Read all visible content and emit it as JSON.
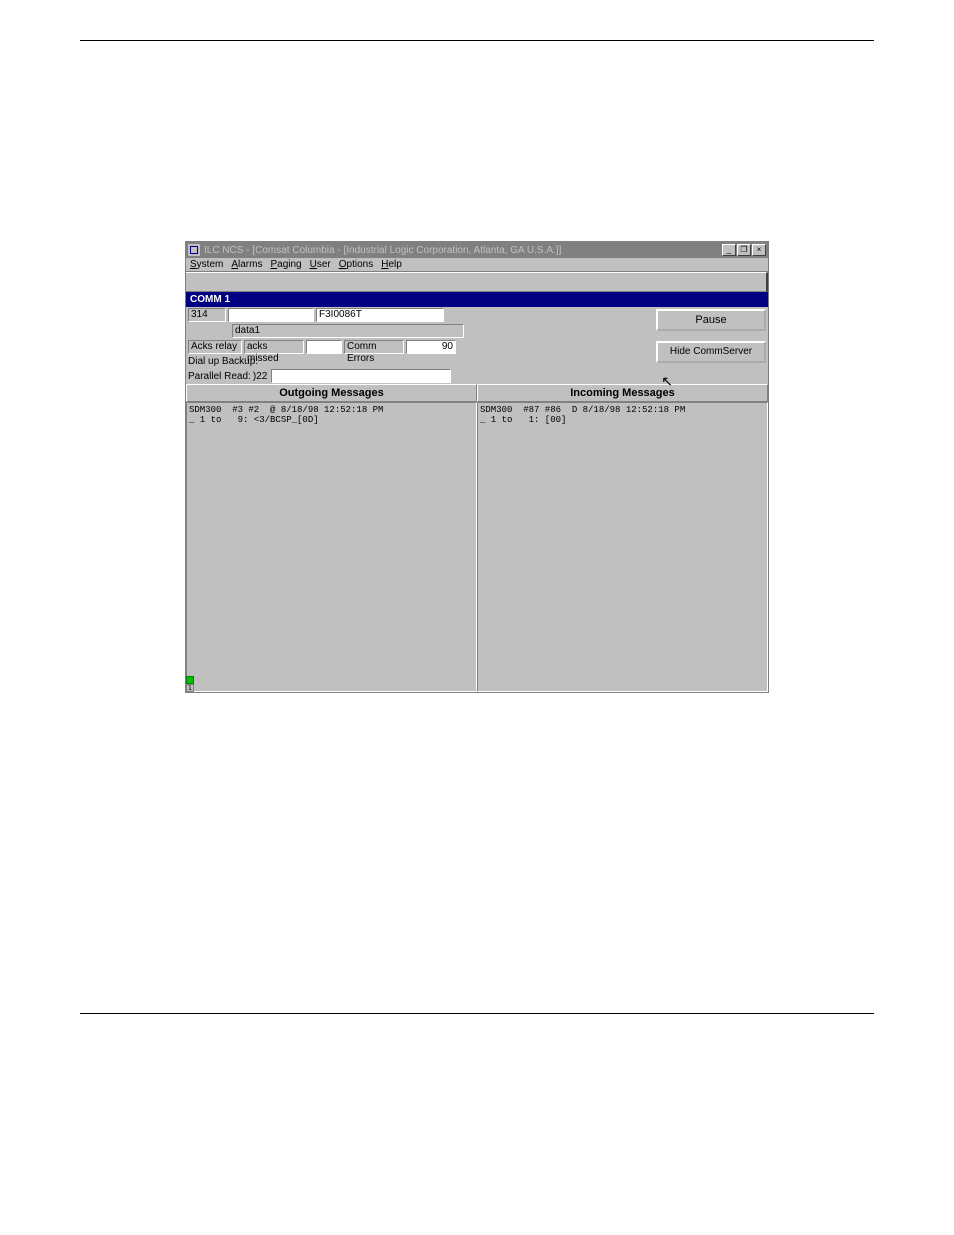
{
  "window": {
    "title": "ILC NCS - [Comsat Columbia - [Industrial Logic Corporation, Atlanta, GA U.S.A.]]"
  },
  "menu": {
    "items": [
      {
        "label": "System",
        "ul": "S"
      },
      {
        "label": "Alarms",
        "ul": "A"
      },
      {
        "label": "Paging",
        "ul": "P"
      },
      {
        "label": "User",
        "ul": "U"
      },
      {
        "label": "Options",
        "ul": "O"
      },
      {
        "label": "Help",
        "ul": "H"
      }
    ]
  },
  "comm": {
    "header": "COMM 1",
    "field1": "314",
    "field2": "",
    "field3": "F3I0086T",
    "data_label": "data1",
    "acks_relay_label": "Acks relay",
    "acks_missed_label": "acks missed",
    "acks_missed_value": "",
    "comm_errors_label": "Comm Errors",
    "comm_errors_value": "90",
    "dialup_label": "Dial up Backup:",
    "parallel_label": "Parallel Read:",
    "parallel_value": ")22"
  },
  "buttons": {
    "pause": "Pause",
    "hide": "Hide CommServer"
  },
  "columns": {
    "outgoing": "Outgoing Messages",
    "incoming": "Incoming Messages"
  },
  "messages": {
    "outgoing": "SDM300  #3 #2  @ 8/18/98 12:52:18 PM\n_ 1 to   9: <3/BCSP_[0D]",
    "incoming": "SDM300  #87 #86  D 8/18/98 12:52:18 PM\n_ 1 to   1: [00]"
  },
  "indicator": {
    "num": "1"
  }
}
